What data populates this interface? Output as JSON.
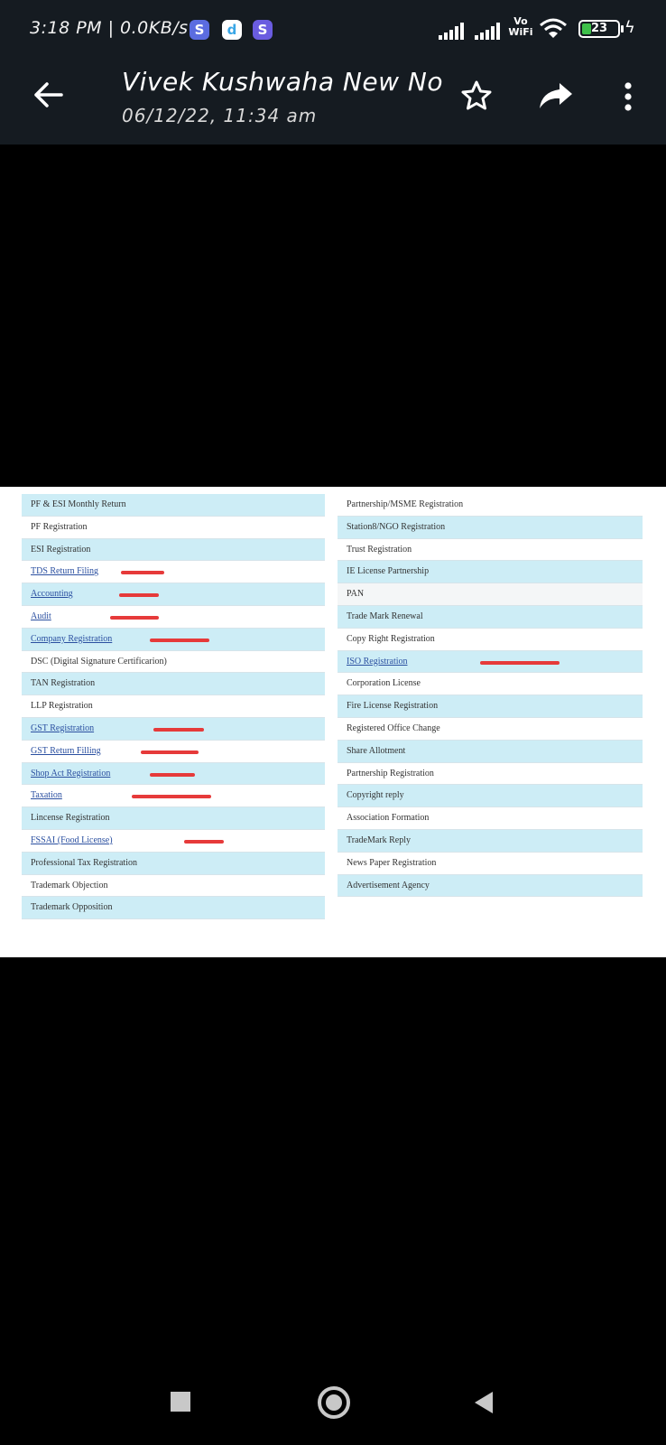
{
  "status_bar": {
    "time": "3:18 PM | 0.0KB/s",
    "notification_icons": [
      "S",
      "d",
      "S"
    ],
    "vowifi_top": "Vo",
    "vowifi_bottom": "WiFi",
    "battery": "23"
  },
  "header": {
    "title": "Vivek Kushwaha New No",
    "subtitle": "06/12/22, 11:34 am",
    "icons": [
      "back-arrow-icon",
      "star-icon",
      "share-icon",
      "more-vert-icon"
    ]
  },
  "document": {
    "left_column": [
      {
        "label": "PF & ESI Monthly Return",
        "style": "blue",
        "link": false,
        "marked": false
      },
      {
        "label": "PF Registration",
        "style": "white",
        "link": false,
        "marked": false
      },
      {
        "label": "ESI Registration",
        "style": "blue",
        "link": false,
        "marked": false
      },
      {
        "label": "TDS Return Filing",
        "style": "white",
        "link": true,
        "marked": true
      },
      {
        "label": "Accounting",
        "style": "blue",
        "link": true,
        "marked": true
      },
      {
        "label": "Audit",
        "style": "white",
        "link": true,
        "marked": true
      },
      {
        "label": "Company Registration",
        "style": "blue",
        "link": true,
        "marked": true
      },
      {
        "label": "DSC (Digital Signature Certificarion)",
        "style": "white",
        "link": false,
        "marked": false
      },
      {
        "label": "TAN Registration",
        "style": "blue",
        "link": false,
        "marked": false
      },
      {
        "label": "LLP Registration",
        "style": "white",
        "link": false,
        "marked": false
      },
      {
        "label": "GST Registration",
        "style": "blue",
        "link": true,
        "marked": true
      },
      {
        "label": "GST Return Filling",
        "style": "white",
        "link": true,
        "marked": true
      },
      {
        "label": "Shop Act Registration",
        "style": "blue",
        "link": true,
        "marked": true
      },
      {
        "label": "Taxation",
        "style": "white",
        "link": true,
        "marked": true
      },
      {
        "label": "Lincense Registration",
        "style": "blue",
        "link": false,
        "marked": false
      },
      {
        "label": "FSSAI (Food License)",
        "style": "white",
        "link": true,
        "marked": true
      },
      {
        "label": "Professional Tax Registration",
        "style": "blue",
        "link": false,
        "marked": false
      },
      {
        "label": "Trademark Objection",
        "style": "white",
        "link": false,
        "marked": false
      },
      {
        "label": "Trademark Opposition",
        "style": "blue",
        "link": false,
        "marked": false
      }
    ],
    "right_column": [
      {
        "label": "Partnership/MSME Registration",
        "style": "white",
        "link": false,
        "marked": false
      },
      {
        "label": "Station8/NGO Registration",
        "style": "blue",
        "link": false,
        "marked": false
      },
      {
        "label": "Trust Registration",
        "style": "white",
        "link": false,
        "marked": false
      },
      {
        "label": "IE License Partnership",
        "style": "blue",
        "link": false,
        "marked": false
      },
      {
        "label": "PAN",
        "style": "gray",
        "link": false,
        "marked": false
      },
      {
        "label": "Trade Mark Renewal",
        "style": "blue",
        "link": false,
        "marked": false
      },
      {
        "label": "Copy Right Registration",
        "style": "white",
        "link": false,
        "marked": false
      },
      {
        "label": "ISO Registration",
        "style": "blue",
        "link": true,
        "marked": true
      },
      {
        "label": "Corporation License",
        "style": "white",
        "link": false,
        "marked": false
      },
      {
        "label": "Fire License Registration",
        "style": "blue",
        "link": false,
        "marked": false
      },
      {
        "label": "Registered Office Change",
        "style": "white",
        "link": false,
        "marked": false
      },
      {
        "label": "Share Allotment",
        "style": "blue",
        "link": false,
        "marked": false
      },
      {
        "label": "Partnership Registration",
        "style": "white",
        "link": false,
        "marked": false
      },
      {
        "label": "Copyright reply",
        "style": "blue",
        "link": false,
        "marked": false
      },
      {
        "label": "Association Formation",
        "style": "white",
        "link": false,
        "marked": false
      },
      {
        "label": "TradeMark Reply",
        "style": "blue",
        "link": false,
        "marked": false
      },
      {
        "label": "News Paper Registration",
        "style": "white",
        "link": false,
        "marked": false
      },
      {
        "label": "Advertisement Agency",
        "style": "blue",
        "link": false,
        "marked": false
      }
    ]
  },
  "colors": {
    "header_bg": "#151b21",
    "row_blue": "#cdedf6",
    "link": "#2a4fa0",
    "red_mark": "#e63a3a"
  },
  "navigation": {
    "icons": [
      "recents-square-icon",
      "home-circle-icon",
      "back-triangle-icon"
    ]
  }
}
